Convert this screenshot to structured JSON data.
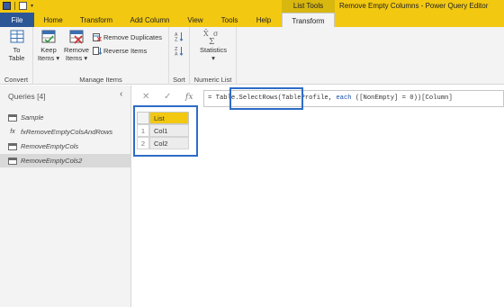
{
  "window": {
    "title": "Remove Empty Columns - Power Query Editor",
    "contextual_group": "List Tools"
  },
  "tabs": {
    "file": "File",
    "home": "Home",
    "transform": "Transform",
    "add_column": "Add Column",
    "view": "View",
    "tools": "Tools",
    "help": "Help",
    "contextual_transform": "Transform"
  },
  "ribbon": {
    "convert": {
      "to_table_line1": "To",
      "to_table_line2": "Table",
      "label": "Convert"
    },
    "manage_items": {
      "keep_line1": "Keep",
      "keep_line2": "Items",
      "remove_line1": "Remove",
      "remove_line2": "Items",
      "remove_duplicates": "Remove Duplicates",
      "reverse_items": "Reverse Items",
      "label": "Manage Items"
    },
    "sort": {
      "label": "Sort"
    },
    "numeric_list": {
      "statistics": "Statistics",
      "label": "Numeric List"
    }
  },
  "queries": {
    "header": "Queries [4]",
    "items": [
      {
        "name": "Sample",
        "type": "table"
      },
      {
        "name": "fxRemoveEmptyColsAndRows",
        "type": "function"
      },
      {
        "name": "RemoveEmptyCols",
        "type": "table"
      },
      {
        "name": "RemoveEmptyCols2",
        "type": "table",
        "selected": true
      }
    ]
  },
  "formula_bar": {
    "fx": "fx",
    "part1": "= Table.SelectRows(TableProfile, ",
    "keyword": "each",
    "part2": " ([NonEmpty] = 0))[Column]"
  },
  "grid": {
    "column_header": "List",
    "rows": [
      {
        "index": "1",
        "value": "Col1"
      },
      {
        "index": "2",
        "value": "Col2"
      }
    ]
  },
  "colors": {
    "accent": "#f2c811",
    "file_tab": "#2b5797",
    "highlight": "#2e6cc8"
  }
}
